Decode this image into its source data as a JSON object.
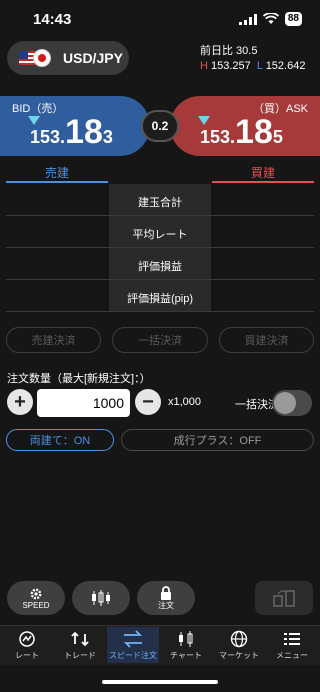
{
  "status_bar": {
    "time": "14:43",
    "battery": "88"
  },
  "pair": {
    "label": "USD/JPY"
  },
  "quote_info": {
    "prev_label": "前日比 30.5",
    "high_prefix": "H",
    "high": "153.257",
    "low_prefix": "L",
    "low": "152.642"
  },
  "bid": {
    "title": "BID（売）",
    "small": "153.",
    "big": "18",
    "pip": "3"
  },
  "ask": {
    "title": "（買）ASK",
    "small": "153.",
    "big": "18",
    "pip": "5"
  },
  "spread": "0.2",
  "positions": {
    "sell_header": "売建",
    "buy_header": "買建",
    "rows": [
      "建玉合計",
      "平均レート",
      "評価損益",
      "評価損益(pip)"
    ]
  },
  "settle_buttons": [
    "売建決済",
    "一括決済",
    "買建決済"
  ],
  "order": {
    "qty_label": "注文数量（最大[新規注文]：）",
    "qty_value": "1000",
    "multiplier": "x1,000",
    "bulk_label": "一括決済"
  },
  "options": {
    "both_side": "両建て：ON",
    "nariyuki_plus": "成行プラス：OFF"
  },
  "float_buttons": {
    "speed": "SPEED",
    "order": "注文"
  },
  "tabs": [
    {
      "label": "レート",
      "icon": "rate-icon"
    },
    {
      "label": "トレード",
      "icon": "trade-icon"
    },
    {
      "label": "スピード注文",
      "icon": "speed-order-icon",
      "active": true
    },
    {
      "label": "チャート",
      "icon": "chart-icon"
    },
    {
      "label": "マーケット",
      "icon": "market-globe-icon"
    },
    {
      "label": "メニュー",
      "icon": "menu-icon"
    }
  ],
  "colors": {
    "bid": "#2f5d9e",
    "ask": "#a63a3a",
    "sell": "#4a90e2",
    "buy": "#e05252",
    "background": "#161616"
  }
}
